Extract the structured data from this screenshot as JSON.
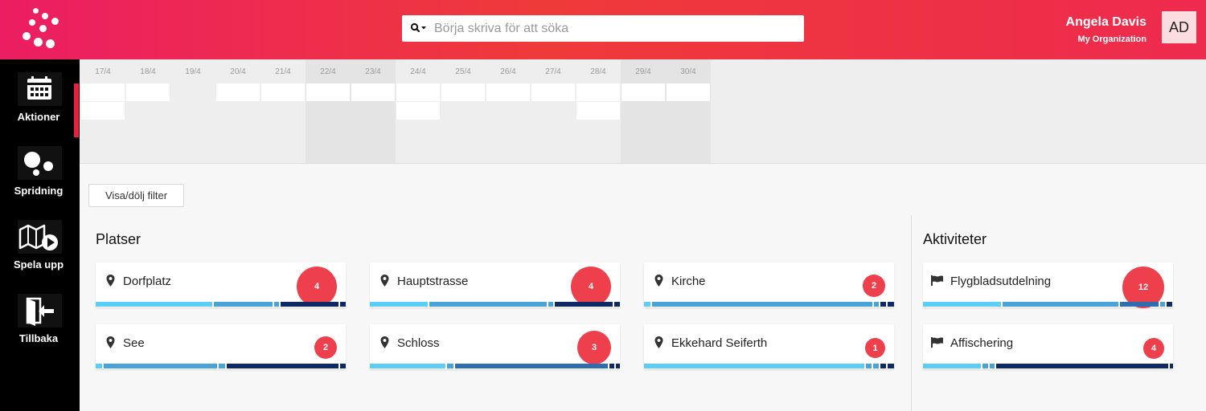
{
  "header": {
    "search": {
      "placeholder": "Börja skriva för att söka",
      "icon": "search-icon"
    },
    "user": {
      "name": "Angela Davis",
      "organization": "My Organization",
      "initials": "AD"
    },
    "colors": {
      "gradient_start": "#ec1d63",
      "gradient_mid": "#ef3a3a",
      "accent": "#ee3f4c"
    }
  },
  "sidebar": {
    "items": [
      {
        "label": "Aktioner",
        "icon": "calendar-icon"
      },
      {
        "label": "Spridning",
        "icon": "bubbles-icon",
        "active": true
      },
      {
        "label": "Spela upp",
        "icon": "map-play-icon"
      },
      {
        "label": "Tillbaka",
        "icon": "exit-icon"
      }
    ]
  },
  "calendar": {
    "dates": [
      "17/4",
      "18/4",
      "19/4",
      "20/4",
      "21/4",
      "22/4",
      "23/4",
      "24/4",
      "25/4",
      "26/4",
      "27/4",
      "28/4",
      "29/4",
      "30/4"
    ]
  },
  "filter": {
    "label": "Visa/dölj filter"
  },
  "places": {
    "title": "Platser",
    "items": [
      {
        "name": "Dorfplatz",
        "count": "4"
      },
      {
        "name": "Hauptstrasse",
        "count": "4"
      },
      {
        "name": "Kirche",
        "count": "2"
      },
      {
        "name": "See",
        "count": "2"
      },
      {
        "name": "Schloss",
        "count": "3"
      },
      {
        "name": "Ekkehard Seiferth",
        "count": "1"
      }
    ]
  },
  "activities": {
    "title": "Aktiviteter",
    "items": [
      {
        "name": "Flygbladsutdelning",
        "count": "12"
      },
      {
        "name": "Affischering",
        "count": "4"
      }
    ]
  },
  "bar_colors": [
    "#5ccdf5",
    "#4aa3d8",
    "#2e6db0",
    "#0d2a66"
  ]
}
